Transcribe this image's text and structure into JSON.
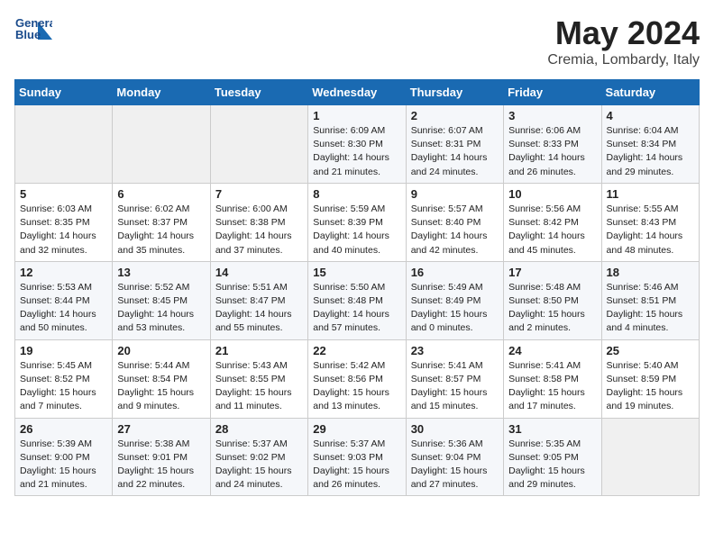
{
  "header": {
    "logo_line1": "General",
    "logo_line2": "Blue",
    "month": "May 2024",
    "location": "Cremia, Lombardy, Italy"
  },
  "weekdays": [
    "Sunday",
    "Monday",
    "Tuesday",
    "Wednesday",
    "Thursday",
    "Friday",
    "Saturday"
  ],
  "weeks": [
    [
      {
        "day": "",
        "info": ""
      },
      {
        "day": "",
        "info": ""
      },
      {
        "day": "",
        "info": ""
      },
      {
        "day": "1",
        "info": "Sunrise: 6:09 AM\nSunset: 8:30 PM\nDaylight: 14 hours\nand 21 minutes."
      },
      {
        "day": "2",
        "info": "Sunrise: 6:07 AM\nSunset: 8:31 PM\nDaylight: 14 hours\nand 24 minutes."
      },
      {
        "day": "3",
        "info": "Sunrise: 6:06 AM\nSunset: 8:33 PM\nDaylight: 14 hours\nand 26 minutes."
      },
      {
        "day": "4",
        "info": "Sunrise: 6:04 AM\nSunset: 8:34 PM\nDaylight: 14 hours\nand 29 minutes."
      }
    ],
    [
      {
        "day": "5",
        "info": "Sunrise: 6:03 AM\nSunset: 8:35 PM\nDaylight: 14 hours\nand 32 minutes."
      },
      {
        "day": "6",
        "info": "Sunrise: 6:02 AM\nSunset: 8:37 PM\nDaylight: 14 hours\nand 35 minutes."
      },
      {
        "day": "7",
        "info": "Sunrise: 6:00 AM\nSunset: 8:38 PM\nDaylight: 14 hours\nand 37 minutes."
      },
      {
        "day": "8",
        "info": "Sunrise: 5:59 AM\nSunset: 8:39 PM\nDaylight: 14 hours\nand 40 minutes."
      },
      {
        "day": "9",
        "info": "Sunrise: 5:57 AM\nSunset: 8:40 PM\nDaylight: 14 hours\nand 42 minutes."
      },
      {
        "day": "10",
        "info": "Sunrise: 5:56 AM\nSunset: 8:42 PM\nDaylight: 14 hours\nand 45 minutes."
      },
      {
        "day": "11",
        "info": "Sunrise: 5:55 AM\nSunset: 8:43 PM\nDaylight: 14 hours\nand 48 minutes."
      }
    ],
    [
      {
        "day": "12",
        "info": "Sunrise: 5:53 AM\nSunset: 8:44 PM\nDaylight: 14 hours\nand 50 minutes."
      },
      {
        "day": "13",
        "info": "Sunrise: 5:52 AM\nSunset: 8:45 PM\nDaylight: 14 hours\nand 53 minutes."
      },
      {
        "day": "14",
        "info": "Sunrise: 5:51 AM\nSunset: 8:47 PM\nDaylight: 14 hours\nand 55 minutes."
      },
      {
        "day": "15",
        "info": "Sunrise: 5:50 AM\nSunset: 8:48 PM\nDaylight: 14 hours\nand 57 minutes."
      },
      {
        "day": "16",
        "info": "Sunrise: 5:49 AM\nSunset: 8:49 PM\nDaylight: 15 hours\nand 0 minutes."
      },
      {
        "day": "17",
        "info": "Sunrise: 5:48 AM\nSunset: 8:50 PM\nDaylight: 15 hours\nand 2 minutes."
      },
      {
        "day": "18",
        "info": "Sunrise: 5:46 AM\nSunset: 8:51 PM\nDaylight: 15 hours\nand 4 minutes."
      }
    ],
    [
      {
        "day": "19",
        "info": "Sunrise: 5:45 AM\nSunset: 8:52 PM\nDaylight: 15 hours\nand 7 minutes."
      },
      {
        "day": "20",
        "info": "Sunrise: 5:44 AM\nSunset: 8:54 PM\nDaylight: 15 hours\nand 9 minutes."
      },
      {
        "day": "21",
        "info": "Sunrise: 5:43 AM\nSunset: 8:55 PM\nDaylight: 15 hours\nand 11 minutes."
      },
      {
        "day": "22",
        "info": "Sunrise: 5:42 AM\nSunset: 8:56 PM\nDaylight: 15 hours\nand 13 minutes."
      },
      {
        "day": "23",
        "info": "Sunrise: 5:41 AM\nSunset: 8:57 PM\nDaylight: 15 hours\nand 15 minutes."
      },
      {
        "day": "24",
        "info": "Sunrise: 5:41 AM\nSunset: 8:58 PM\nDaylight: 15 hours\nand 17 minutes."
      },
      {
        "day": "25",
        "info": "Sunrise: 5:40 AM\nSunset: 8:59 PM\nDaylight: 15 hours\nand 19 minutes."
      }
    ],
    [
      {
        "day": "26",
        "info": "Sunrise: 5:39 AM\nSunset: 9:00 PM\nDaylight: 15 hours\nand 21 minutes."
      },
      {
        "day": "27",
        "info": "Sunrise: 5:38 AM\nSunset: 9:01 PM\nDaylight: 15 hours\nand 22 minutes."
      },
      {
        "day": "28",
        "info": "Sunrise: 5:37 AM\nSunset: 9:02 PM\nDaylight: 15 hours\nand 24 minutes."
      },
      {
        "day": "29",
        "info": "Sunrise: 5:37 AM\nSunset: 9:03 PM\nDaylight: 15 hours\nand 26 minutes."
      },
      {
        "day": "30",
        "info": "Sunrise: 5:36 AM\nSunset: 9:04 PM\nDaylight: 15 hours\nand 27 minutes."
      },
      {
        "day": "31",
        "info": "Sunrise: 5:35 AM\nSunset: 9:05 PM\nDaylight: 15 hours\nand 29 minutes."
      },
      {
        "day": "",
        "info": ""
      }
    ]
  ]
}
